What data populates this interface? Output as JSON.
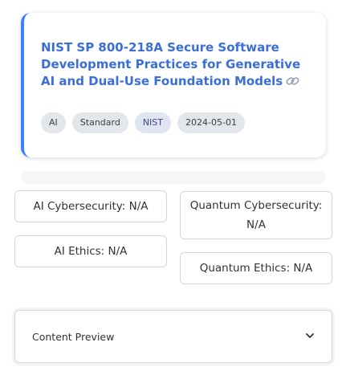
{
  "card": {
    "title": "NIST SP 800-218A Secure Software Development Practices for Generative AI and Dual-Use Foundation Models",
    "link_icon": "link-icon",
    "accent_color": "#3b82f6",
    "tags": [
      "AI",
      "Standard",
      "NIST",
      "2024-05-01"
    ]
  },
  "metrics": {
    "ai_cybersecurity": "AI Cybersecurity: N/A",
    "ai_ethics": "AI Ethics: N/A",
    "quantum_cybersecurity": "Quantum Cybersecurity: N/A",
    "quantum_ethics": "Quantum Ethics: N/A"
  },
  "expander": {
    "label": "Content Preview",
    "icon": "chevron-down-icon"
  }
}
